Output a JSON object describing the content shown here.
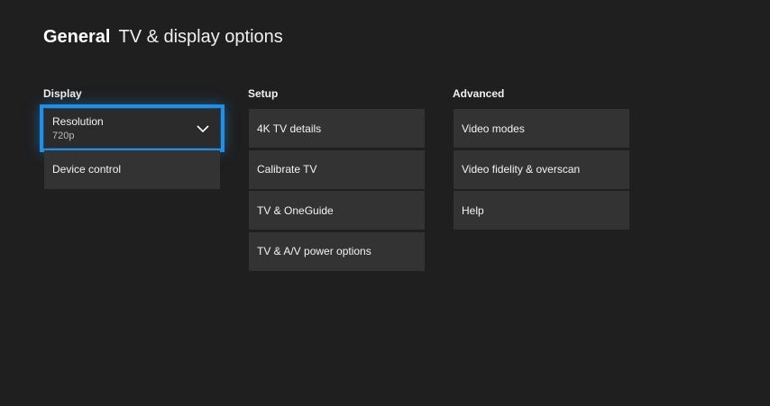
{
  "header": {
    "section": "General",
    "title": "TV & display options"
  },
  "display": {
    "heading": "Display",
    "resolution": {
      "label": "Resolution",
      "value": "720p"
    },
    "items": [
      "Device control"
    ]
  },
  "setup": {
    "heading": "Setup",
    "items": [
      "4K TV details",
      "Calibrate TV",
      "TV & OneGuide",
      "TV & A/V power options"
    ]
  },
  "advanced": {
    "heading": "Advanced",
    "items": [
      "Video modes",
      "Video fidelity & overscan",
      "Help"
    ]
  },
  "colors": {
    "background": "#1f1f1f",
    "tile": "#333333",
    "focus_accent": "#1f8fe8"
  }
}
